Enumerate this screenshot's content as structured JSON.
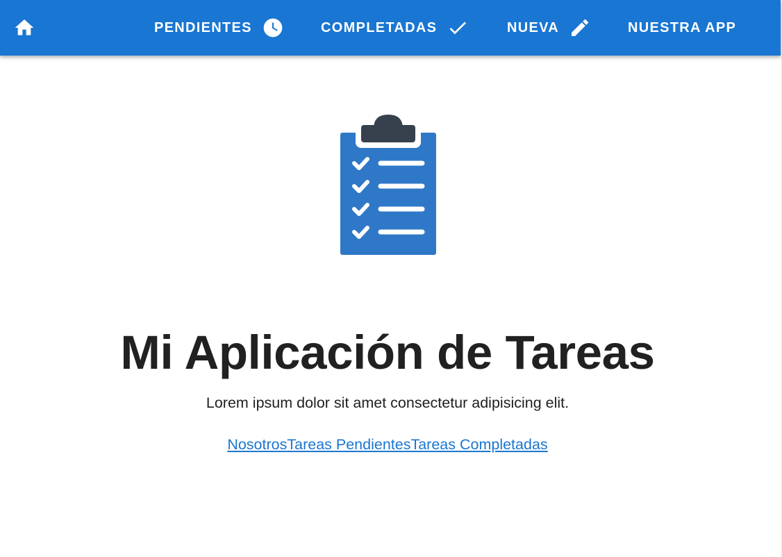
{
  "colors": {
    "appbar_bg": "#1976d2",
    "appbar_text": "#ffffff",
    "title_text": "#212121",
    "link_text": "#1976d2",
    "clipboard_body": "#2e78c7",
    "clipboard_clip": "#37414d"
  },
  "appbar": {
    "home_icon": "home-icon",
    "nav": [
      {
        "label": "PENDIENTES",
        "icon": "clock-icon"
      },
      {
        "label": "COMPLETADAS",
        "icon": "check-icon"
      },
      {
        "label": "NUEVA",
        "icon": "pencil-icon"
      },
      {
        "label": "NUESTRA APP",
        "icon": ""
      }
    ]
  },
  "hero": {
    "illustration": "clipboard-checklist-icon",
    "title": "Mi Aplicación de Tareas",
    "subtitle": "Lorem ipsum dolor sit amet consectetur adipisicing elit.",
    "links": [
      {
        "label": "Nosotros"
      },
      {
        "label": "Tareas Pendientes"
      },
      {
        "label": "Tareas Completadas"
      }
    ]
  }
}
